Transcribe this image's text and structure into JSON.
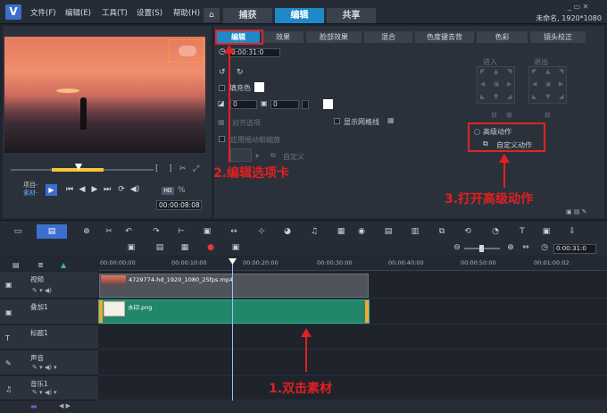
{
  "titlebar": {
    "menus": [
      "文件(F)",
      "编辑(E)",
      "工具(T)",
      "设置(S)",
      "帮助(H)"
    ],
    "tabs": [
      "捕获",
      "编辑",
      "共享"
    ],
    "project_info": "未命名, 1920*1080"
  },
  "player": {
    "project_label": "项目-",
    "clip_label": "素材-",
    "timecode": "00:00:08:08",
    "zoom_pct": "%",
    "bracket_left": "[",
    "bracket_right": "]"
  },
  "panel": {
    "tabs": [
      "编辑",
      "效果",
      "脸部效果",
      "混合",
      "色度键去背",
      "色彩",
      "镜头校正"
    ],
    "duration": "0:00:31:0",
    "fill_color_label": "填充色",
    "spin1": "0",
    "spin2": "0",
    "spin3": "0",
    "align_options": "对齐选项",
    "show_grid": "显示网格线",
    "apply_tilt": "应用摇动和缩放",
    "custom": "自定义",
    "enter_label": "进入",
    "exit_label": "退出",
    "advanced_motion": "高级动作",
    "custom_motion": "自定义动作"
  },
  "annotations": {
    "step1": "1.双击素材",
    "step2": "2.编辑选项卡",
    "step3": "3.打开高级动作"
  },
  "timeline": {
    "timecode": "0:00:31:0",
    "ruler": [
      "00:00:00:00",
      "00:00:10:00",
      "00:00:20:00",
      "00:00:30:00",
      "00:00:40:00",
      "00:00:50:00",
      "00:01:00:02"
    ],
    "tracks": [
      "视频",
      "叠加1",
      "标题1",
      "声音",
      "音乐1"
    ],
    "video_clip": "4729774-hd_1920_1080_25fps.mp4",
    "overlay_clip": "水印.png"
  },
  "colors": {
    "accent": "#1e88c9",
    "annotation": "#e32020",
    "overlay_clip": "#22866a"
  }
}
